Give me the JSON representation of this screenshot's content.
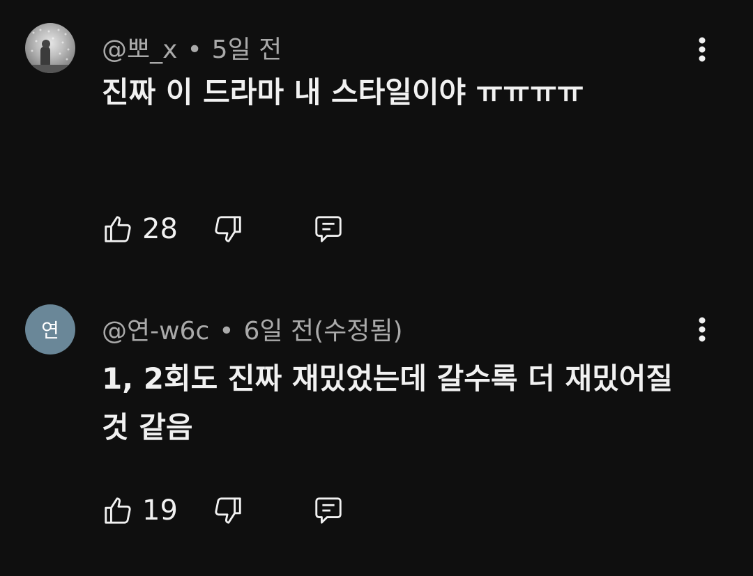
{
  "comments": [
    {
      "author": "@뽀_x",
      "time": "5일 전",
      "separator": "•",
      "text": "진짜 이 드라마 내 스타일이야 ㅠㅠㅠㅠ",
      "likes": "28",
      "avatar": "photo"
    },
    {
      "author": "@연-w6c",
      "time": "6일 전(수정됨)",
      "separator": "•",
      "text": "1, 2회도 진짜 재밌었는데 갈수록 더 재밌어질 것 같음",
      "likes": "19",
      "avatar_letter": "연"
    }
  ],
  "icons": {
    "like": "thumbs-up-icon",
    "dislike": "thumbs-down-icon",
    "reply": "comment-icon",
    "more": "more-vertical-icon"
  },
  "colors": {
    "background": "#0f0f0f",
    "text": "#f1f1f1",
    "meta": "#aaaaaa",
    "avatar_letter_bg": "#6a8798"
  }
}
